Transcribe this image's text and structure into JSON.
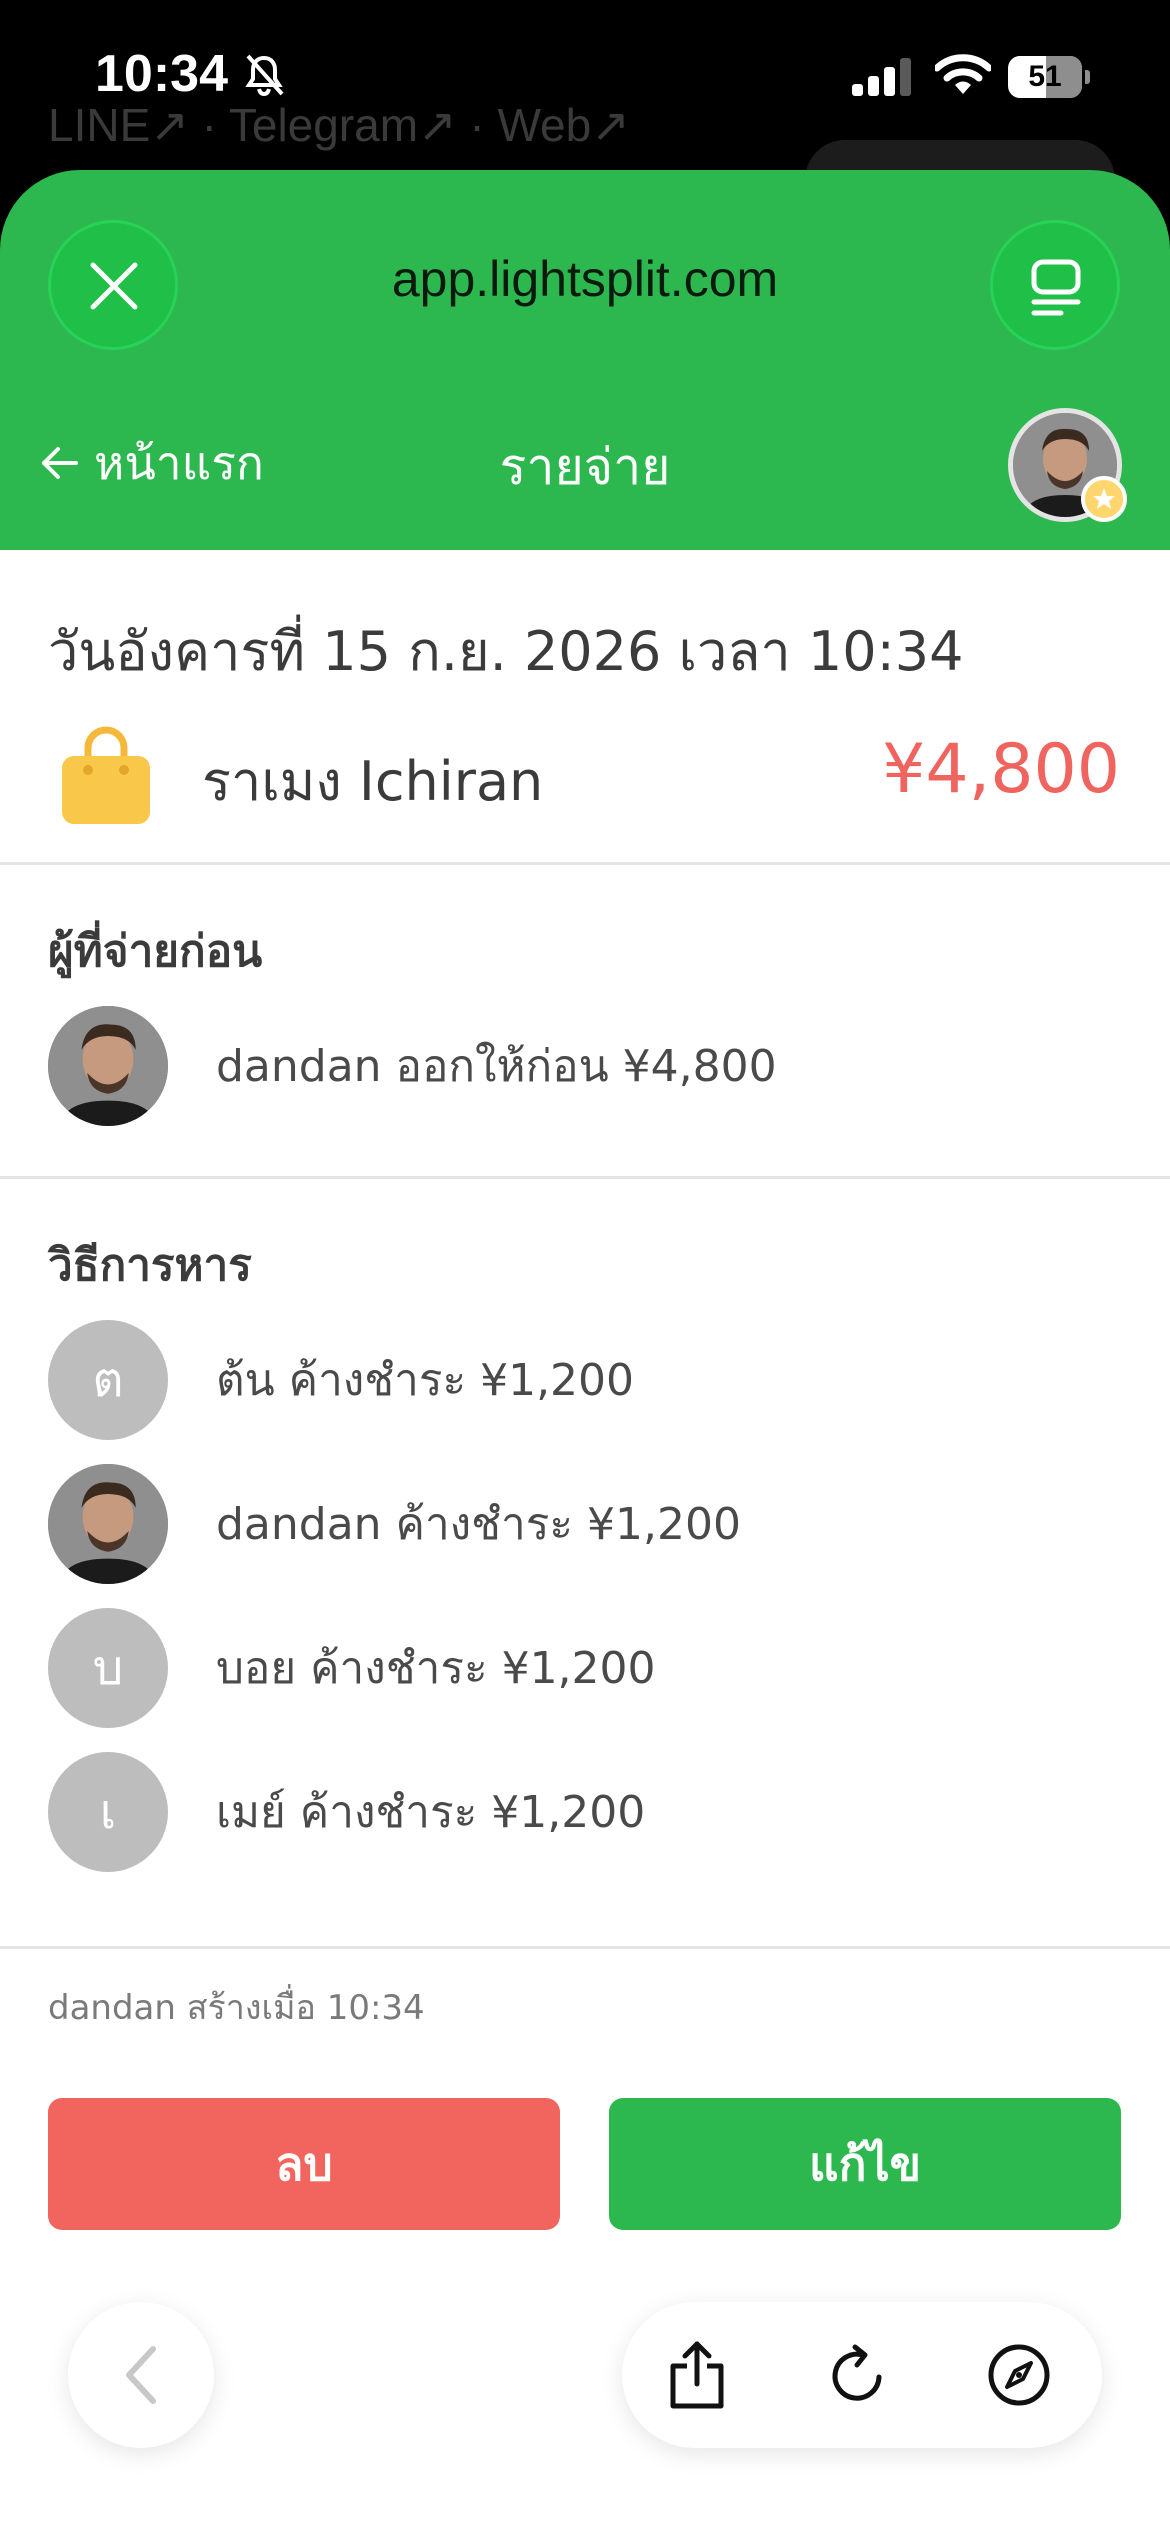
{
  "status_bar": {
    "time": "10:34",
    "battery": "51"
  },
  "background": {
    "links": "LINE↗ · Telegram↗ · Web↗"
  },
  "browser": {
    "url": "app.lightsplit.com"
  },
  "nav": {
    "back_label": "หน้าแรก",
    "title": "รายจ่าย"
  },
  "expense": {
    "date": "วันอังคารที่ 15 ก.ย. 2026 เวลา 10:34",
    "name": "ราเมง Ichiran",
    "amount": "¥4,800",
    "icon": "shopping-bag-icon"
  },
  "paid_by": {
    "title": "ผู้ที่จ่ายก่อน",
    "items": [
      {
        "avatar": "photo",
        "text": "dandan ออกให้ก่อน ¥4,800"
      }
    ]
  },
  "split": {
    "title": "วิธีการหาร",
    "items": [
      {
        "initial": "ต",
        "text": "ต้น ค้างชำระ ¥1,200"
      },
      {
        "avatar": "photo",
        "text": "dandan ค้างชำระ ¥1,200"
      },
      {
        "initial": "บ",
        "text": "บอย ค้างชำระ ¥1,200"
      },
      {
        "initial": "เ",
        "text": "เมย์ ค้างชำระ ¥1,200"
      }
    ]
  },
  "created": "dandan สร้างเมื่อ 10:34",
  "actions": {
    "delete_label": "ลบ",
    "edit_label": "แก้ไข"
  },
  "colors": {
    "brand_green": "#2db84f",
    "danger_red": "#f2655e",
    "amount_red": "#f0645f",
    "initial_avatar_gray": "#bdbdbd"
  }
}
